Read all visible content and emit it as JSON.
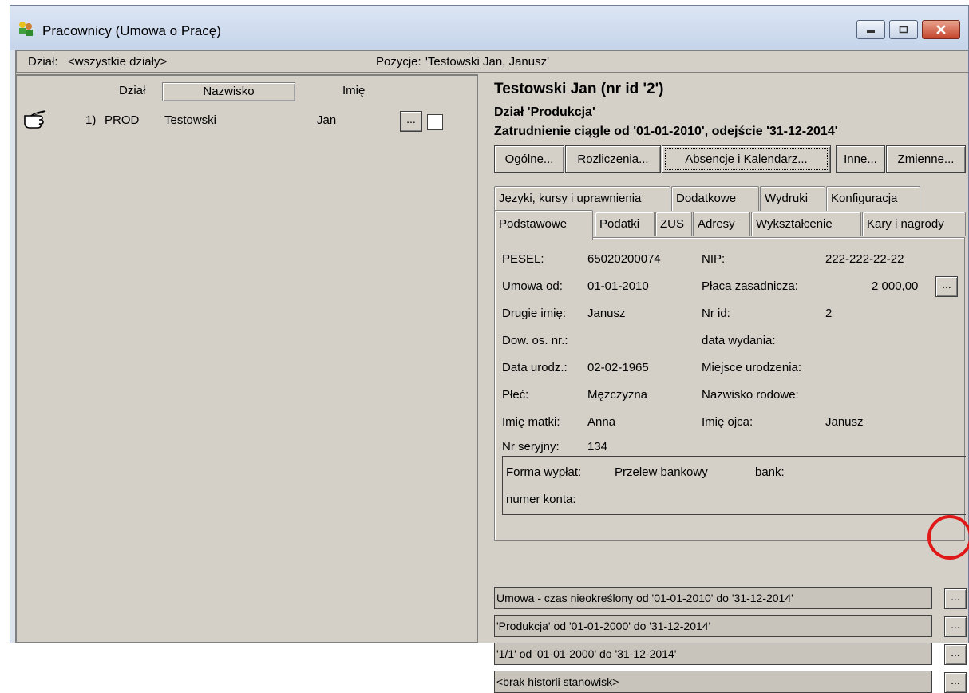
{
  "window": {
    "title": "Pracownicy (Umowa o Pracę)",
    "controls": {
      "minimize": "–",
      "maximize": "□",
      "close": "✕"
    }
  },
  "infobar": {
    "dept_label": "Dział:",
    "dept_value": "<wszystkie działy>",
    "position_label": "Pozycje:",
    "position_value": "'Testowski Jan, Janusz'"
  },
  "list": {
    "columns": {
      "dept": "Dział",
      "surname": "Nazwisko",
      "firstname": "Imię"
    },
    "rows": [
      {
        "index": "1)",
        "dept": "PROD",
        "surname": "Testowski",
        "firstname": "Jan",
        "btn": "..."
      }
    ]
  },
  "employee": {
    "title": "Testowski Jan (nr id '2')",
    "dept": "Dział 'Produkcja'",
    "employment": "Zatrudnienie ciągle od '01-01-2010', odejście '31-12-2014'"
  },
  "buttons": [
    "Ogólne...",
    "Rozliczenia...",
    "Absencje i Kalendarz...",
    "Inne...",
    "Zmienne..."
  ],
  "tabs_row1": [
    "Języki, kursy i uprawnienia",
    "Dodatkowe",
    "Wydruki",
    "Konfiguracja"
  ],
  "tabs_row2": [
    "Podstawowe",
    "Podatki",
    "ZUS",
    "Adresy",
    "Wykształcenie",
    "Kary i nagrody"
  ],
  "fields": {
    "pesel_label": "PESEL:",
    "pesel": "65020200074",
    "nip_label": "NIP:",
    "nip": "222-222-22-22",
    "umowa_label": "Umowa od:",
    "umowa": "01-01-2010",
    "placa_label": "Płaca zasadnicza:",
    "placa": "2 000,00",
    "drugie_label": "Drugie imię:",
    "drugie": "Janusz",
    "nrid_label": "Nr id:",
    "nrid": "2",
    "dowos_label": "Dow. os. nr.:",
    "wydania_label": "data wydania:",
    "urodz_label": "Data urodz.:",
    "urodz": "02-02-1965",
    "miejsce_label": "Miejsce urodzenia:",
    "plec_label": "Płeć:",
    "plec": "Mężczyzna",
    "rodowe_label": "Nazwisko rodowe:",
    "matka_label": "Imię matki:",
    "matka": "Anna",
    "ojciec_label": "Imię ojca:",
    "ojciec": "Janusz",
    "seryjny_label": "Nr seryjny:",
    "seryjny": "134",
    "forma_label": "Forma wypłat:",
    "forma": "Przelew bankowy",
    "bank_label": "bank:",
    "konto_label": "numer konta:"
  },
  "history": [
    "Umowa - czas nieokreślony od '01-01-2010' do '31-12-2014'",
    "'Produkcja' od '01-01-2000' do '31-12-2014'",
    "'1/1' od '01-01-2000' do '31-12-2014'",
    "<brak historii stanowisk>"
  ],
  "history_btn": "...",
  "colors": {
    "face": "#d4d0c8",
    "title_grad": "#c5d4ea",
    "highlight_circle": "#e01818"
  }
}
